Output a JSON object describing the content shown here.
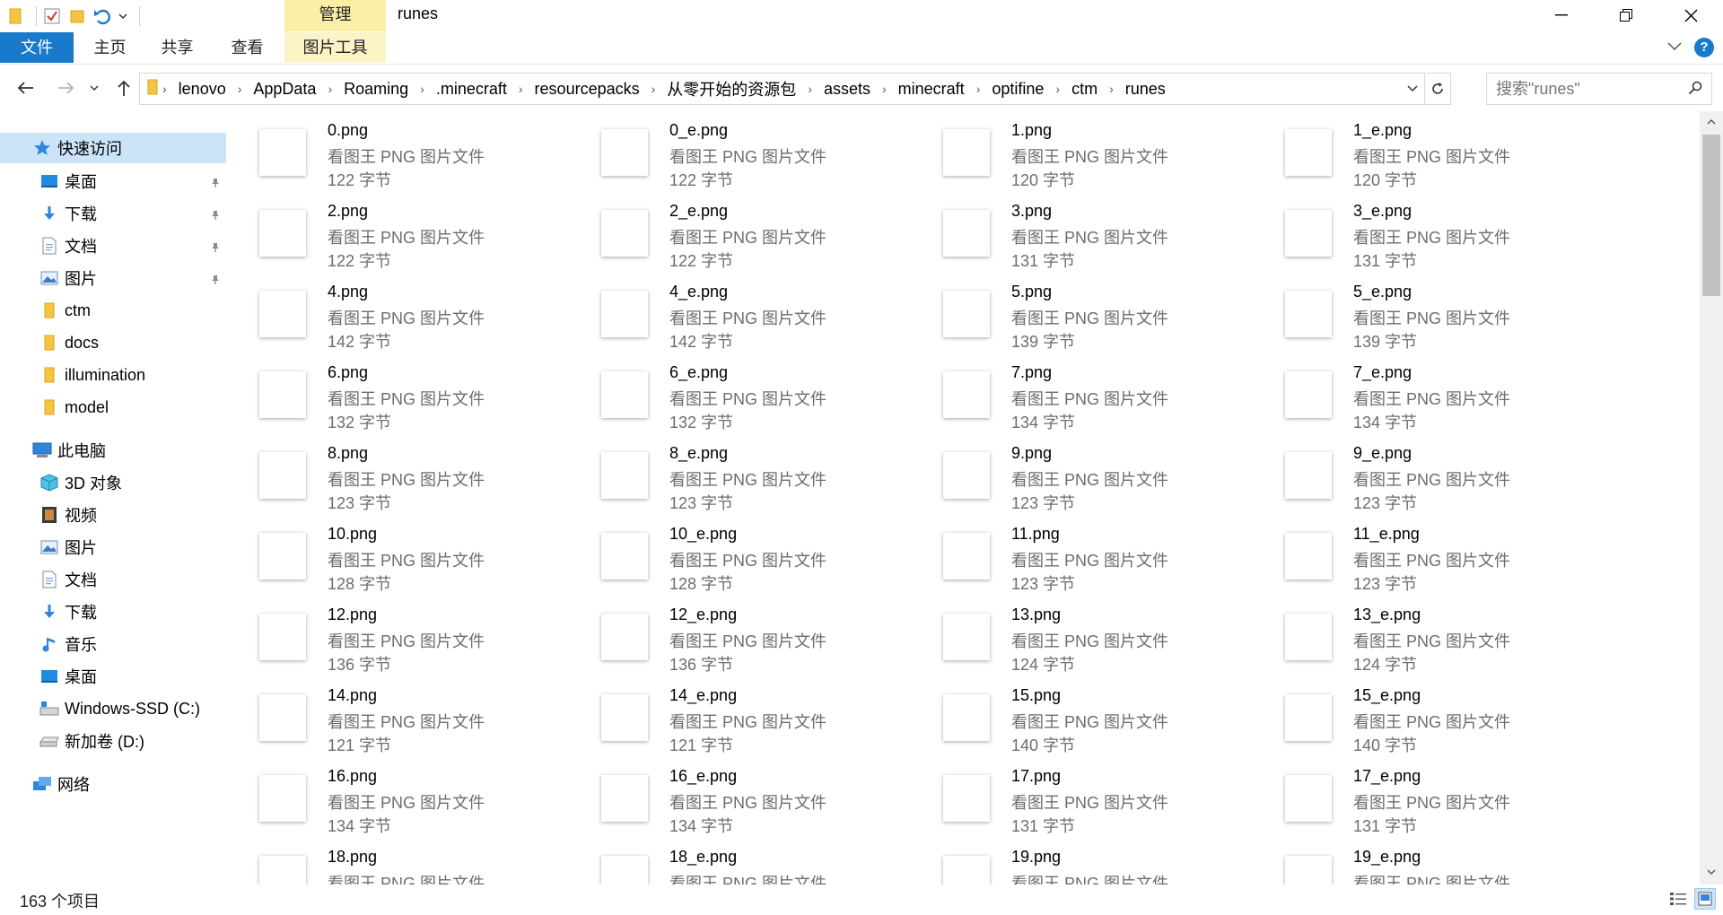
{
  "window": {
    "title": "runes",
    "manage_tab": "管理"
  },
  "ribbon": {
    "tabs": [
      {
        "label": "文件"
      },
      {
        "label": "主页"
      },
      {
        "label": "共享"
      },
      {
        "label": "查看"
      },
      {
        "label": "图片工具"
      }
    ]
  },
  "address": {
    "crumbs": [
      "lenovo",
      "AppData",
      "Roaming",
      ".minecraft",
      "resourcepacks",
      "从零开始的资源包",
      "assets",
      "minecraft",
      "optifine",
      "ctm",
      "runes"
    ]
  },
  "search": {
    "placeholder": "搜索\"runes\""
  },
  "nav": {
    "quick_access": "快速访问",
    "quick_items": [
      {
        "label": "桌面",
        "icon": "desktop-icon",
        "pinned": true
      },
      {
        "label": "下载",
        "icon": "download-icon",
        "pinned": true
      },
      {
        "label": "文档",
        "icon": "document-icon",
        "pinned": true
      },
      {
        "label": "图片",
        "icon": "picture-icon",
        "pinned": true
      },
      {
        "label": "ctm",
        "icon": "folder-icon",
        "pinned": false
      },
      {
        "label": "docs",
        "icon": "folder-icon",
        "pinned": false
      },
      {
        "label": "illumination",
        "icon": "folder-icon",
        "pinned": false
      },
      {
        "label": "model",
        "icon": "folder-icon",
        "pinned": false
      }
    ],
    "this_pc": "此电脑",
    "pc_items": [
      {
        "label": "3D 对象",
        "icon": "3d-objects-icon"
      },
      {
        "label": "视频",
        "icon": "video-icon"
      },
      {
        "label": "图片",
        "icon": "picture-icon"
      },
      {
        "label": "文档",
        "icon": "document-icon"
      },
      {
        "label": "下载",
        "icon": "download-icon"
      },
      {
        "label": "音乐",
        "icon": "music-icon"
      },
      {
        "label": "桌面",
        "icon": "desktop-icon"
      },
      {
        "label": "Windows-SSD (C:)",
        "icon": "drive-c-icon"
      },
      {
        "label": "新加卷 (D:)",
        "icon": "drive-d-icon"
      }
    ],
    "network": "网络"
  },
  "file_type": "看图王 PNG 图片文件",
  "files": [
    {
      "name": "0.png",
      "size": "122 字节"
    },
    {
      "name": "0_e.png",
      "size": "122 字节"
    },
    {
      "name": "1.png",
      "size": "120 字节"
    },
    {
      "name": "1_e.png",
      "size": "120 字节"
    },
    {
      "name": "2.png",
      "size": "122 字节"
    },
    {
      "name": "2_e.png",
      "size": "122 字节"
    },
    {
      "name": "3.png",
      "size": "131 字节"
    },
    {
      "name": "3_e.png",
      "size": "131 字节"
    },
    {
      "name": "4.png",
      "size": "142 字节"
    },
    {
      "name": "4_e.png",
      "size": "142 字节"
    },
    {
      "name": "5.png",
      "size": "139 字节"
    },
    {
      "name": "5_e.png",
      "size": "139 字节"
    },
    {
      "name": "6.png",
      "size": "132 字节"
    },
    {
      "name": "6_e.png",
      "size": "132 字节"
    },
    {
      "name": "7.png",
      "size": "134 字节"
    },
    {
      "name": "7_e.png",
      "size": "134 字节"
    },
    {
      "name": "8.png",
      "size": "123 字节"
    },
    {
      "name": "8_e.png",
      "size": "123 字节"
    },
    {
      "name": "9.png",
      "size": "123 字节"
    },
    {
      "name": "9_e.png",
      "size": "123 字节"
    },
    {
      "name": "10.png",
      "size": "128 字节"
    },
    {
      "name": "10_e.png",
      "size": "128 字节"
    },
    {
      "name": "11.png",
      "size": "123 字节"
    },
    {
      "name": "11_e.png",
      "size": "123 字节"
    },
    {
      "name": "12.png",
      "size": "136 字节"
    },
    {
      "name": "12_e.png",
      "size": "136 字节"
    },
    {
      "name": "13.png",
      "size": "124 字节"
    },
    {
      "name": "13_e.png",
      "size": "124 字节"
    },
    {
      "name": "14.png",
      "size": "121 字节"
    },
    {
      "name": "14_e.png",
      "size": "121 字节"
    },
    {
      "name": "15.png",
      "size": "140 字节"
    },
    {
      "name": "15_e.png",
      "size": "140 字节"
    },
    {
      "name": "16.png",
      "size": "134 字节"
    },
    {
      "name": "16_e.png",
      "size": "134 字节"
    },
    {
      "name": "17.png",
      "size": "131 字节"
    },
    {
      "name": "17_e.png",
      "size": "131 字节"
    },
    {
      "name": "18.png",
      "size": ""
    },
    {
      "name": "18_e.png",
      "size": ""
    },
    {
      "name": "19.png",
      "size": ""
    },
    {
      "name": "19_e.png",
      "size": ""
    }
  ],
  "status": {
    "item_count": "163 个项目"
  },
  "colors": {
    "accent": "#1979ca",
    "manage_tab": "#fbeea6",
    "selection": "#cce4f7"
  }
}
